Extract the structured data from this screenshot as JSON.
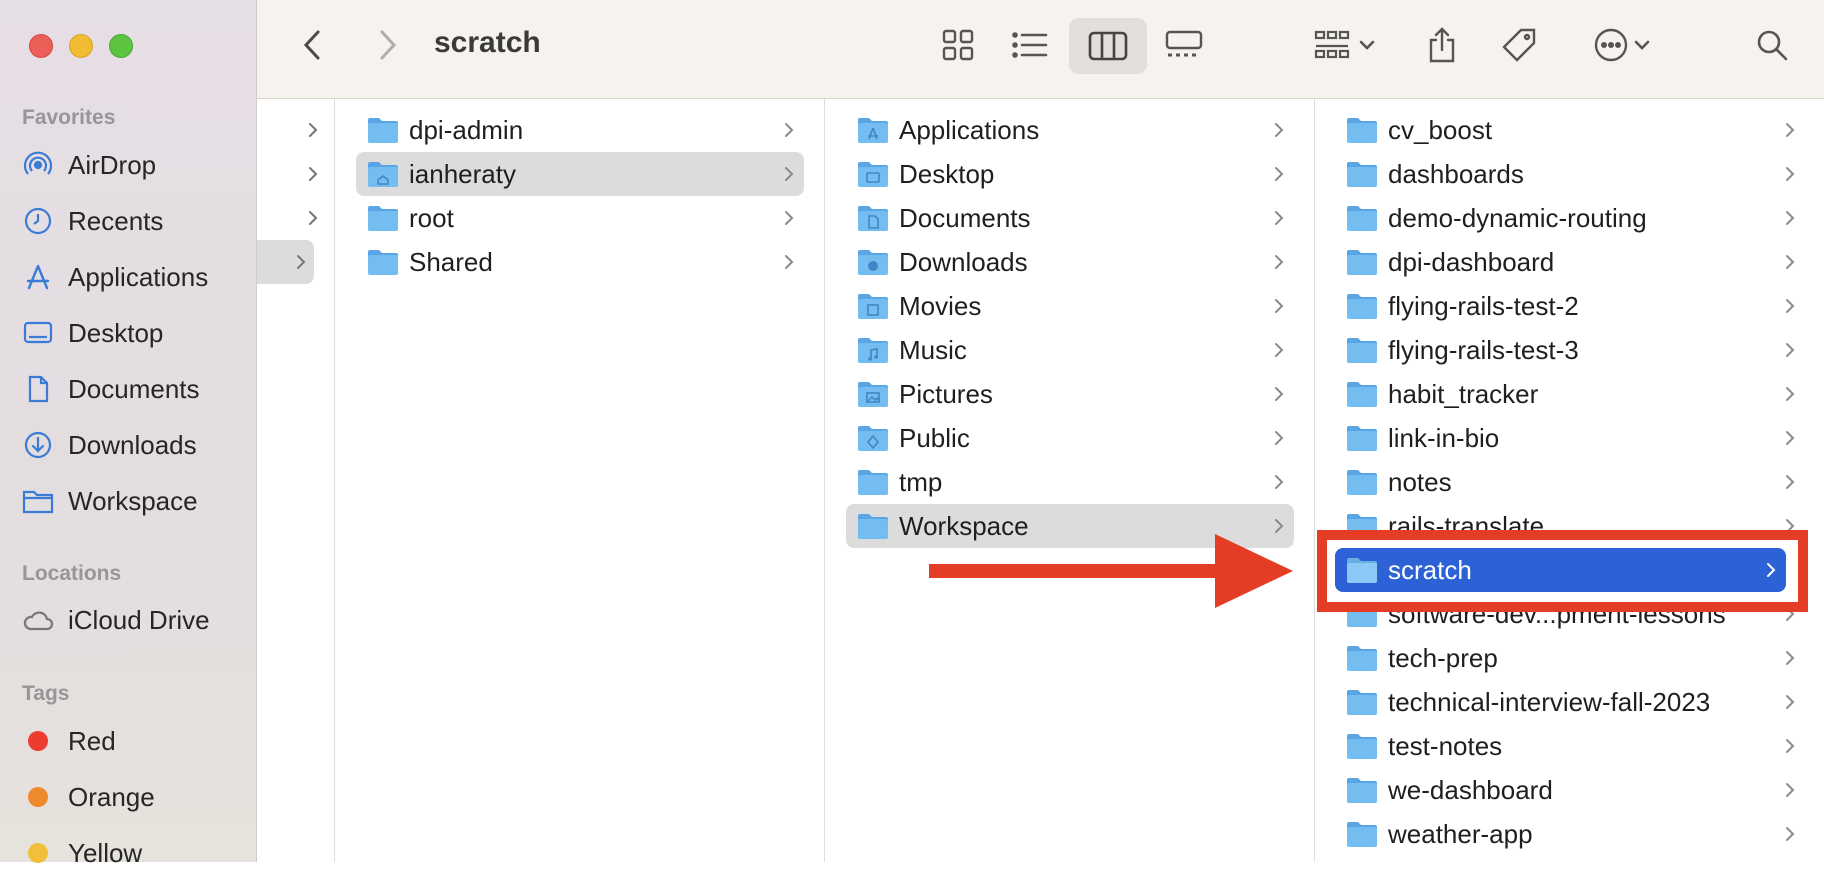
{
  "window": {
    "title": "scratch"
  },
  "sidebar": {
    "favorites_heading": "Favorites",
    "favorites": [
      {
        "label": "AirDrop",
        "icon": "airdrop-icon"
      },
      {
        "label": "Recents",
        "icon": "clock-icon"
      },
      {
        "label": "Applications",
        "icon": "applications-icon"
      },
      {
        "label": "Desktop",
        "icon": "desktop-icon"
      },
      {
        "label": "Documents",
        "icon": "document-icon"
      },
      {
        "label": "Downloads",
        "icon": "download-icon"
      },
      {
        "label": "Workspace",
        "icon": "folder-icon"
      }
    ],
    "locations_heading": "Locations",
    "locations": [
      {
        "label": "iCloud Drive",
        "icon": "cloud-icon"
      }
    ],
    "tags_heading": "Tags",
    "tags": [
      {
        "label": "Red",
        "color": "#ee3b30"
      },
      {
        "label": "Orange",
        "color": "#ef8a2c"
      },
      {
        "label": "Yellow",
        "color": "#f1bf3a"
      }
    ]
  },
  "columns": {
    "col2": [
      {
        "label": "dpi-admin",
        "selected": false,
        "icon": "folder-icon"
      },
      {
        "label": "ianheraty",
        "selected": true,
        "icon": "home-folder-icon"
      },
      {
        "label": "root",
        "selected": false,
        "icon": "folder-icon"
      },
      {
        "label": "Shared",
        "selected": false,
        "icon": "folder-icon"
      }
    ],
    "col3": [
      {
        "label": "Applications",
        "icon": "applications-folder-icon"
      },
      {
        "label": "Desktop",
        "icon": "desktop-folder-icon"
      },
      {
        "label": "Documents",
        "icon": "documents-folder-icon"
      },
      {
        "label": "Downloads",
        "icon": "downloads-folder-icon"
      },
      {
        "label": "Movies",
        "icon": "movies-folder-icon"
      },
      {
        "label": "Music",
        "icon": "music-folder-icon"
      },
      {
        "label": "Pictures",
        "icon": "pictures-folder-icon"
      },
      {
        "label": "Public",
        "icon": "public-folder-icon"
      },
      {
        "label": "tmp",
        "icon": "folder-icon"
      },
      {
        "label": "Workspace",
        "icon": "folder-icon",
        "selected": true
      }
    ],
    "col4": [
      {
        "label": "cv_boost"
      },
      {
        "label": "dashboards"
      },
      {
        "label": "demo-dynamic-routing"
      },
      {
        "label": "dpi-dashboard"
      },
      {
        "label": "flying-rails-test-2"
      },
      {
        "label": "flying-rails-test-3"
      },
      {
        "label": "habit_tracker"
      },
      {
        "label": "link-in-bio"
      },
      {
        "label": "notes"
      },
      {
        "label": "rails-translate"
      },
      {
        "label": "scratch",
        "selected": true
      },
      {
        "label": "software-dev...pment-lessons"
      },
      {
        "label": "tech-prep"
      },
      {
        "label": "technical-interview-fall-2023"
      },
      {
        "label": "test-notes"
      },
      {
        "label": "we-dashboard"
      },
      {
        "label": "weather-app"
      }
    ]
  },
  "colors": {
    "selection_blue": "#2c62d6",
    "annotation_red": "#e53c26",
    "folder_blue": "#6cb6ec"
  }
}
